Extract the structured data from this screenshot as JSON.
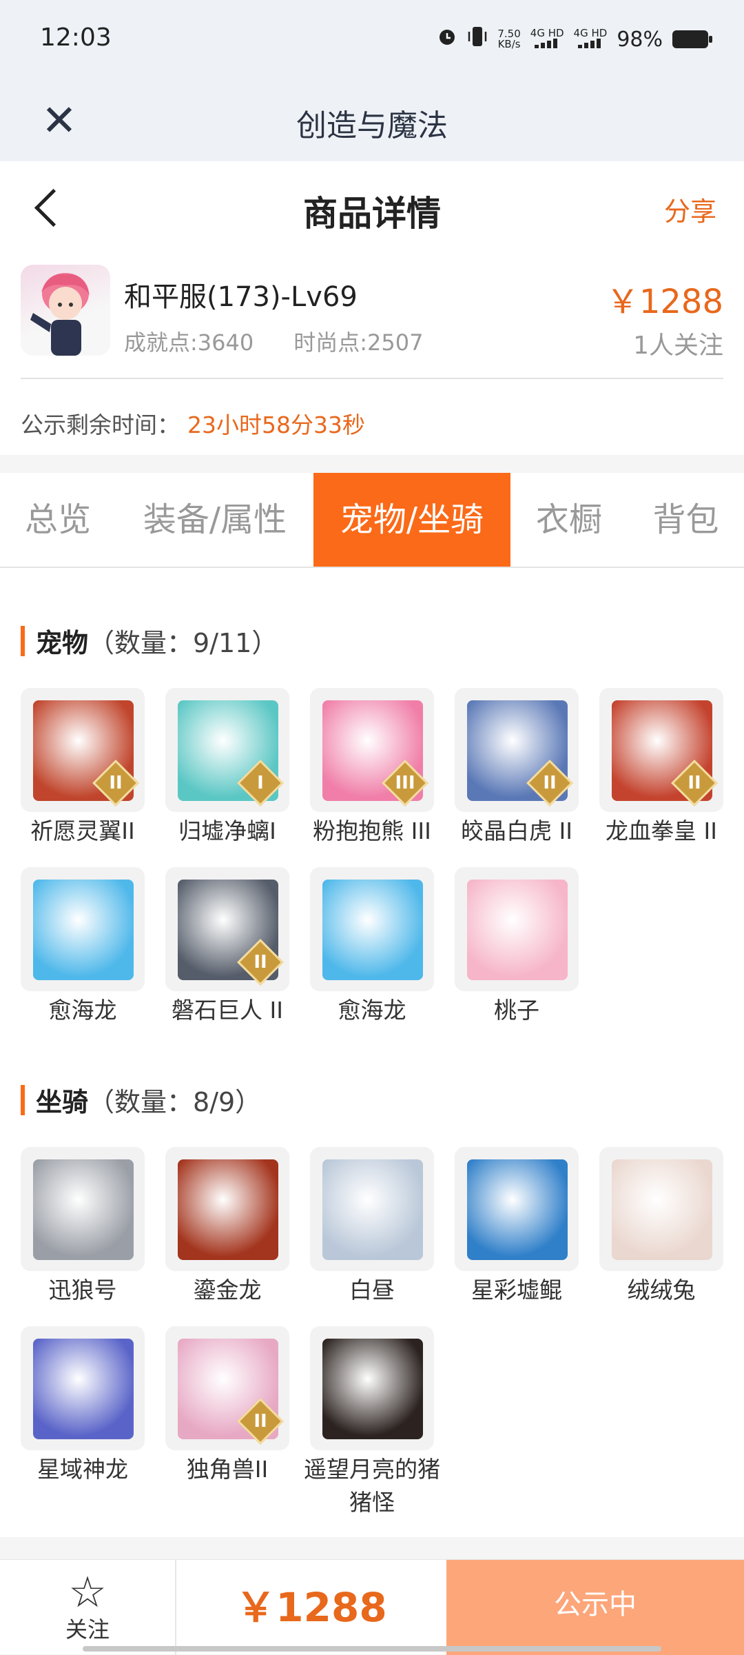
{
  "status_bar": {
    "time": "12:03",
    "net_speed_value": "7.50",
    "net_speed_unit": "KB/s",
    "net1": "4G HD",
    "net2": "4G HD",
    "battery": "98%"
  },
  "app_bar": {
    "title": "创造与魔法",
    "close_icon": "close-icon"
  },
  "header": {
    "title": "商品详情",
    "share": "分享"
  },
  "item": {
    "name": "和平服(173)-Lv69",
    "achievement": "成就点:3640",
    "fashion": "时尚点:2507",
    "price": "￥1288",
    "followers": "1人关注"
  },
  "notice": {
    "label": "公示剩余时间：",
    "time": "23小时58分33秒"
  },
  "tabs": [
    {
      "label": "总览"
    },
    {
      "label": "装备/属性"
    },
    {
      "label": "宠物/坐骑",
      "active": true
    },
    {
      "label": "衣橱"
    },
    {
      "label": "背包"
    }
  ],
  "pets": {
    "title": "宠物",
    "count": "（数量：9/11）",
    "items": [
      {
        "name": "祈愿灵翼II",
        "tier": "II",
        "color": "#c0452c"
      },
      {
        "name": "归墟净螭I",
        "tier": "I",
        "color": "#5bc7c4"
      },
      {
        "name": "粉抱抱熊 III",
        "tier": "III",
        "color": "#f07ea8"
      },
      {
        "name": "皎晶白虎 II",
        "tier": "II",
        "color": "#5a78b6"
      },
      {
        "name": "龙血拳皇 II",
        "tier": "II",
        "color": "#c4432e"
      },
      {
        "name": "愈海龙",
        "tier": "",
        "color": "#4fb8ea"
      },
      {
        "name": "磐石巨人 II",
        "tier": "II",
        "color": "#555d6a"
      },
      {
        "name": "愈海龙",
        "tier": "",
        "color": "#4fb8ea"
      },
      {
        "name": "桃子",
        "tier": "",
        "color": "#f6b5c8"
      }
    ]
  },
  "mounts": {
    "title": "坐骑",
    "count": "（数量：8/9）",
    "items": [
      {
        "name": "迅狼号",
        "tier": "",
        "color": "#9a9ea6"
      },
      {
        "name": "鎏金龙",
        "tier": "",
        "color": "#a3341d"
      },
      {
        "name": "白昼",
        "tier": "",
        "color": "#b9c7d8"
      },
      {
        "name": "星彩墟鲲",
        "tier": "",
        "color": "#2f7fc9"
      },
      {
        "name": "绒绒兔",
        "tier": "",
        "color": "#ead7cf"
      },
      {
        "name": "星域神龙",
        "tier": "",
        "color": "#5a64c8"
      },
      {
        "name": "独角兽II",
        "tier": "II",
        "color": "#e7a8c4"
      },
      {
        "name": "遥望月亮的猪猪怪",
        "tier": "",
        "color": "#2c2320"
      }
    ]
  },
  "bottom": {
    "follow_label": "关注",
    "price": "￥1288",
    "status_button": "公示中"
  },
  "colors": {
    "accent": "#fb6a18",
    "price": "#e8681c",
    "button_disabled": "#fca67a"
  }
}
